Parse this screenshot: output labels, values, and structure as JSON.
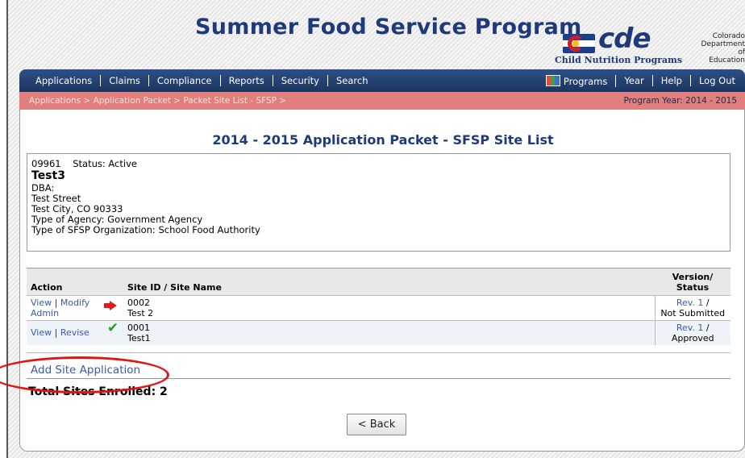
{
  "header": {
    "site_title": "Summer Food Service Program",
    "logo_text": "cde",
    "logo_subtitle": "Child Nutrition Programs",
    "dept_line1": "Colorado",
    "dept_line2": "Department",
    "dept_line3": "of",
    "dept_line4": "Education"
  },
  "nav": {
    "left": [
      "Applications",
      "Claims",
      "Compliance",
      "Reports",
      "Security",
      "Search"
    ],
    "right": [
      "Programs",
      "Year",
      "Help",
      "Log Out"
    ]
  },
  "breadcrumb": {
    "path": "Applications > Application Packet > Packet Site List - SFSP >",
    "program_year": "Program Year: 2014 - 2015"
  },
  "page": {
    "heading": "2014 - 2015 Application Packet - SFSP Site List"
  },
  "sponsor": {
    "id": "09961",
    "status": "Status: Active",
    "name": "Test3",
    "dba": "DBA:",
    "street": "Test Street",
    "city": "Test City, CO 90333",
    "agency_type": "Type of Agency: Government Agency",
    "org_type": "Type of SFSP Organization: School Food Authority"
  },
  "table": {
    "col_action": "Action",
    "col_site": "Site ID / Site Name",
    "col_status_1": "Version/",
    "col_status_2": "Status",
    "rows": [
      {
        "action_1": "View",
        "action_2": "Modify",
        "action_3": "Admin",
        "site_id": "0002",
        "site_name": "Test 2",
        "version": "Rev. 1",
        "status": "Not Submitted",
        "icon": "red-arrow-icon"
      },
      {
        "action_1": "View",
        "action_2": "Revise",
        "site_id": "0001",
        "site_name": "Test1",
        "version": "Rev. 1",
        "status": "Approved",
        "icon": "green-check-icon"
      }
    ]
  },
  "add_site_label": "Add Site Application",
  "total_label": "Total Sites Enrolled: 2",
  "back_label": "< Back",
  "colors": {
    "title_blue": "#1f3a7a",
    "nav_blue": "#1b355f",
    "breadcrumb_red": "#e07f7b",
    "annotation_red": "#e11414"
  }
}
